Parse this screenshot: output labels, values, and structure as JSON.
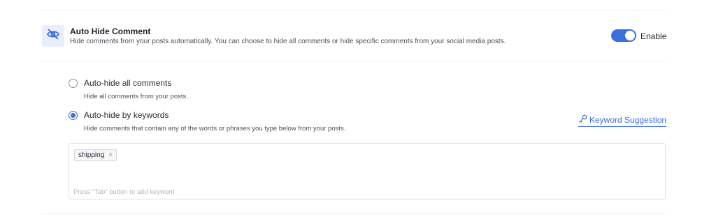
{
  "feature": {
    "title": "Auto Hide Comment",
    "description": "Hide comments from your posts automatically. You can choose to hide all comments or hide specific comments from your social media posts.",
    "icon": "eye-slash-icon",
    "toggle_label": "Enable",
    "toggle_on": true
  },
  "options": [
    {
      "label": "Auto-hide all comments",
      "description": "Hide all comments from your posts.",
      "selected": false
    },
    {
      "label": "Auto-hide by keywords",
      "description": "Hide comments that contain any of the words or phrases you type below from your posts.",
      "selected": true
    }
  ],
  "keyword_suggestion": {
    "label": "Keyword Suggestion",
    "icon": "key-icon"
  },
  "keywords": {
    "tags": [
      "shipping"
    ],
    "remove_glyph": "×",
    "placeholder": "Press “Tab” button to add keyword"
  },
  "colors": {
    "accent": "#3d6fdc",
    "icon_bg": "#e9eefb"
  }
}
